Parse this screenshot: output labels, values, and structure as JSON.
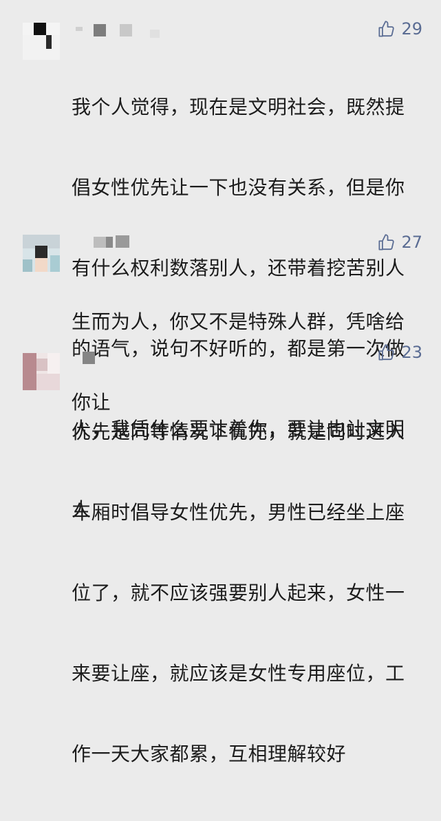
{
  "comments": [
    {
      "likes": "29",
      "lines": [
        "我个人觉得，现在是文明社会，既然提",
        "倡女性优先让一下也没有关系，但是你",
        "有什么权利数落别人，还带着挖苦别人",
        "的语气，说句不好听的，都是第一次做",
        "人，我凭什么要让着你，要让也让文明",
        "人"
      ]
    },
    {
      "likes": "27",
      "lines": [
        "生而为人，你又不是特殊人群，凭啥给",
        "你让"
      ]
    },
    {
      "likes": "23",
      "lines": [
        "优先是同等情况下优先，就是同时进入",
        "车厢时倡导女性优先，男性已经坐上座",
        "位了，就不应该强要别人起来，女性一",
        "来要让座，就应该是女性专用座位，工",
        "作一天大家都累，互相理解较好"
      ]
    }
  ],
  "icons": {
    "like": "thumbs-up-icon"
  },
  "colors": {
    "background": "#ebebeb",
    "like_color": "#5a6c93",
    "text_color": "#1c1c1c"
  }
}
